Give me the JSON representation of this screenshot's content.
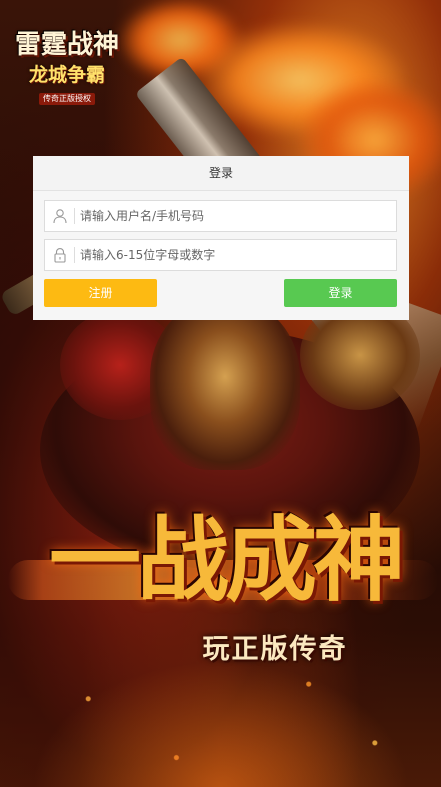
{
  "logo": {
    "title": "雷霆战神",
    "subtitle": "龙城争霸",
    "tag": "传奇正版授权"
  },
  "login": {
    "header": "登录",
    "username": {
      "placeholder": "请输入用户名/手机号码",
      "value": "",
      "icon": "user-icon"
    },
    "password": {
      "placeholder": "请输入6-15位字母或数字",
      "value": "",
      "icon": "lock-icon"
    },
    "register_label": "注册",
    "login_label": "登录"
  },
  "banner": {
    "slogan": "一战成神",
    "tagline": "玩正版传奇"
  },
  "colors": {
    "register_button": "#fdba12",
    "login_button": "#58c951",
    "panel_background": "#f6f6f6"
  }
}
